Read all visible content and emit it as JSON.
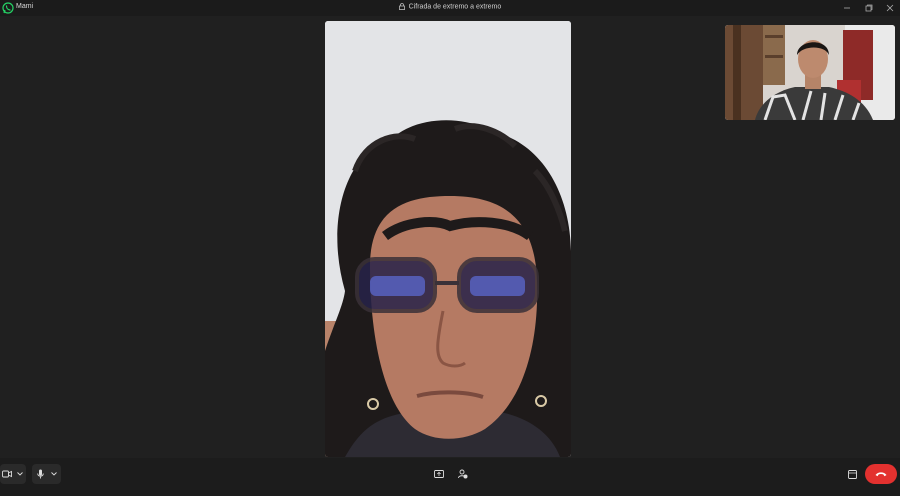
{
  "window": {
    "app_title": "Mami",
    "call_status": "Cifrada de extremo a extremo",
    "brand_color": "#25d366"
  },
  "controls": {
    "video_icon": "video-camera-icon",
    "mic_icon": "microphone-icon",
    "screen_share_icon": "screen-share-icon",
    "add_participant_icon": "add-participant-icon",
    "layout_icon": "layout-icon",
    "end_call_icon": "phone-hangup-icon",
    "end_call_color": "#e3312f"
  }
}
